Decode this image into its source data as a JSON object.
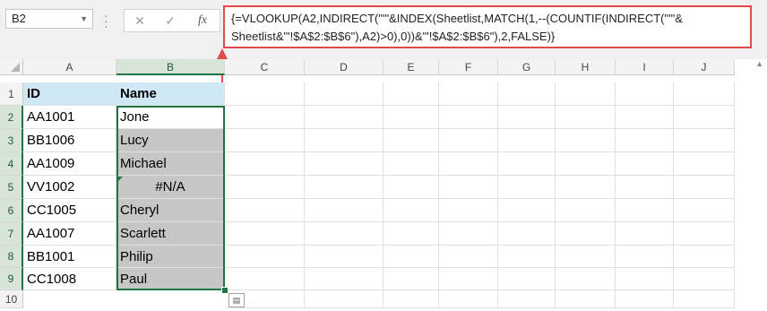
{
  "name_box": {
    "value": "B2"
  },
  "formula_buttons": {
    "cancel": "✕",
    "enter": "✓",
    "fx": "fx"
  },
  "formula_bar": {
    "line1": "{=VLOOKUP(A2,INDIRECT(\"'\"&INDEX(Sheetlist,MATCH(1,--(COUNTIF(INDIRECT(\"'\"&",
    "line2": "Sheetlist&\"'!$A$2:$B$6\"),A2)>0),0))&\"'!$A$2:$B$6\"),2,FALSE)}"
  },
  "columns": [
    "A",
    "B",
    "C",
    "D",
    "E",
    "F",
    "G",
    "H",
    "I",
    "J"
  ],
  "rows": [
    "1",
    "2",
    "3",
    "4",
    "5",
    "6",
    "7",
    "8",
    "9",
    "10"
  ],
  "table": {
    "header": {
      "a": "ID",
      "b": "Name"
    },
    "data": [
      {
        "a": "AA1001",
        "b": "Jone"
      },
      {
        "a": "BB1006",
        "b": "Lucy"
      },
      {
        "a": "AA1009",
        "b": "Michael"
      },
      {
        "a": "VV1002",
        "b": "#N/A"
      },
      {
        "a": "CC1005",
        "b": "Cheryl"
      },
      {
        "a": "AA1007",
        "b": "Scarlett"
      },
      {
        "a": "BB1001",
        "b": "Philip"
      },
      {
        "a": "CC1008",
        "b": "Paul"
      }
    ]
  },
  "colors": {
    "header_fill": "#cfe8f6",
    "gray_fill": "#c6c6c6",
    "selection": "#217346",
    "callout": "#e04a4a"
  },
  "icons": {
    "name_box_dropdown": "chevron-down-icon",
    "paste_options": "paste-options-icon"
  }
}
